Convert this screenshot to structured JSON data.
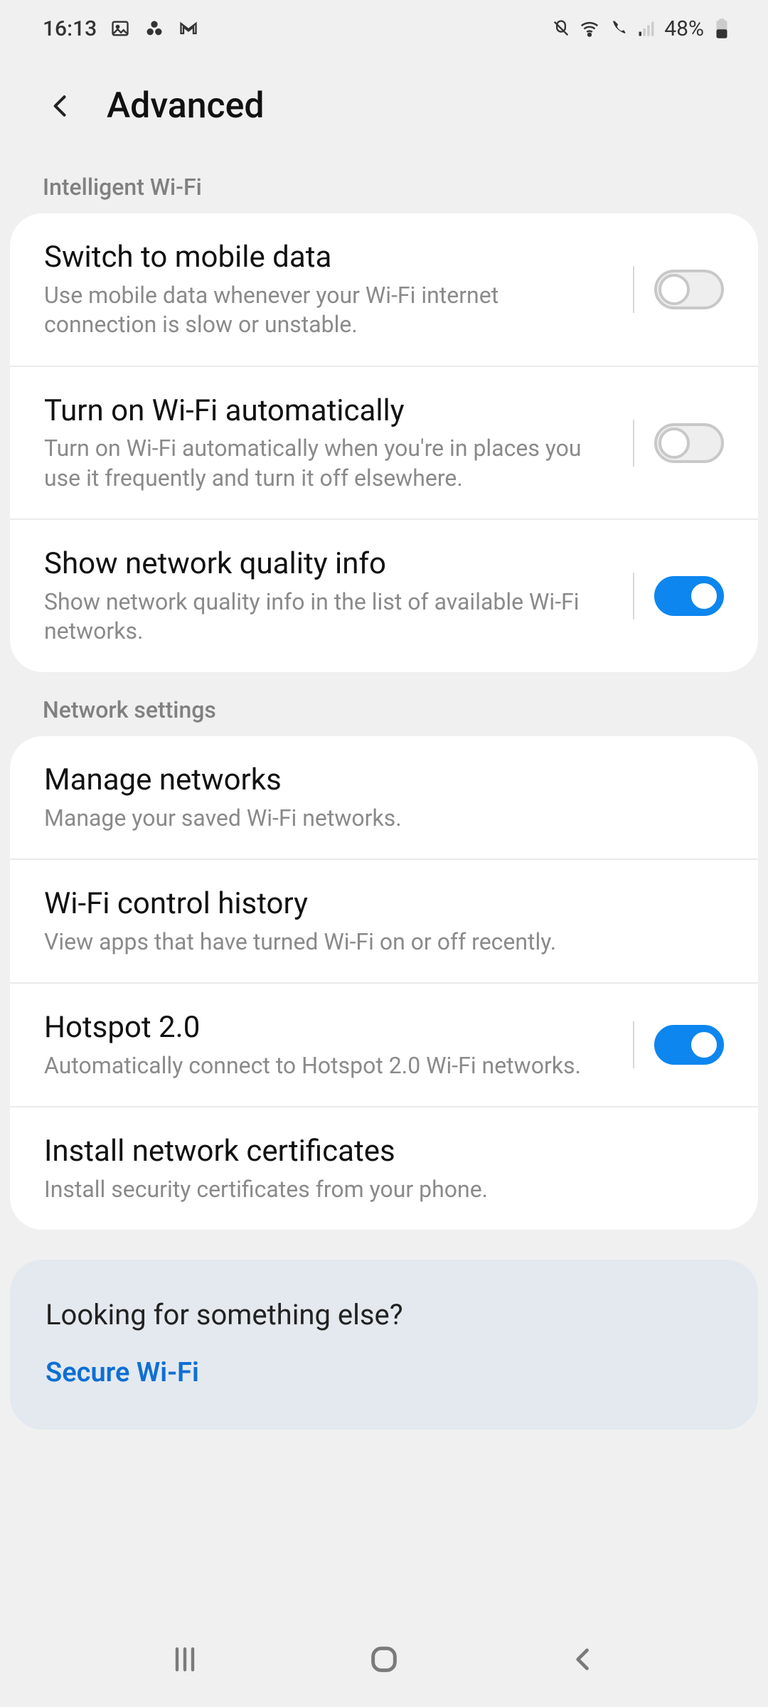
{
  "status": {
    "time": "16:13",
    "battery_text": "48%"
  },
  "header": {
    "title": "Advanced"
  },
  "sections": {
    "intelligent": {
      "label": "Intelligent Wi-Fi",
      "items": [
        {
          "title": "Switch to mobile data",
          "sub": "Use mobile data whenever your Wi-Fi internet connection is slow or unstable.",
          "toggle": false
        },
        {
          "title": "Turn on Wi-Fi automatically",
          "sub": "Turn on Wi-Fi automatically when you're in places you use it frequently and turn it off elsewhere.",
          "toggle": false
        },
        {
          "title": "Show network quality info",
          "sub": "Show network quality info in the list of available Wi-Fi networks.",
          "toggle": true
        }
      ]
    },
    "network": {
      "label": "Network settings",
      "items": [
        {
          "title": "Manage networks",
          "sub": "Manage your saved Wi-Fi networks."
        },
        {
          "title": "Wi-Fi control history",
          "sub": "View apps that have turned Wi-Fi on or off recently."
        },
        {
          "title": "Hotspot 2.0",
          "sub": "Automatically connect to Hotspot 2.0 Wi-Fi networks.",
          "toggle": true
        },
        {
          "title": "Install network certificates",
          "sub": "Install security certificates from your phone."
        }
      ]
    }
  },
  "related": {
    "title": "Looking for something else?",
    "link": "Secure Wi-Fi"
  }
}
